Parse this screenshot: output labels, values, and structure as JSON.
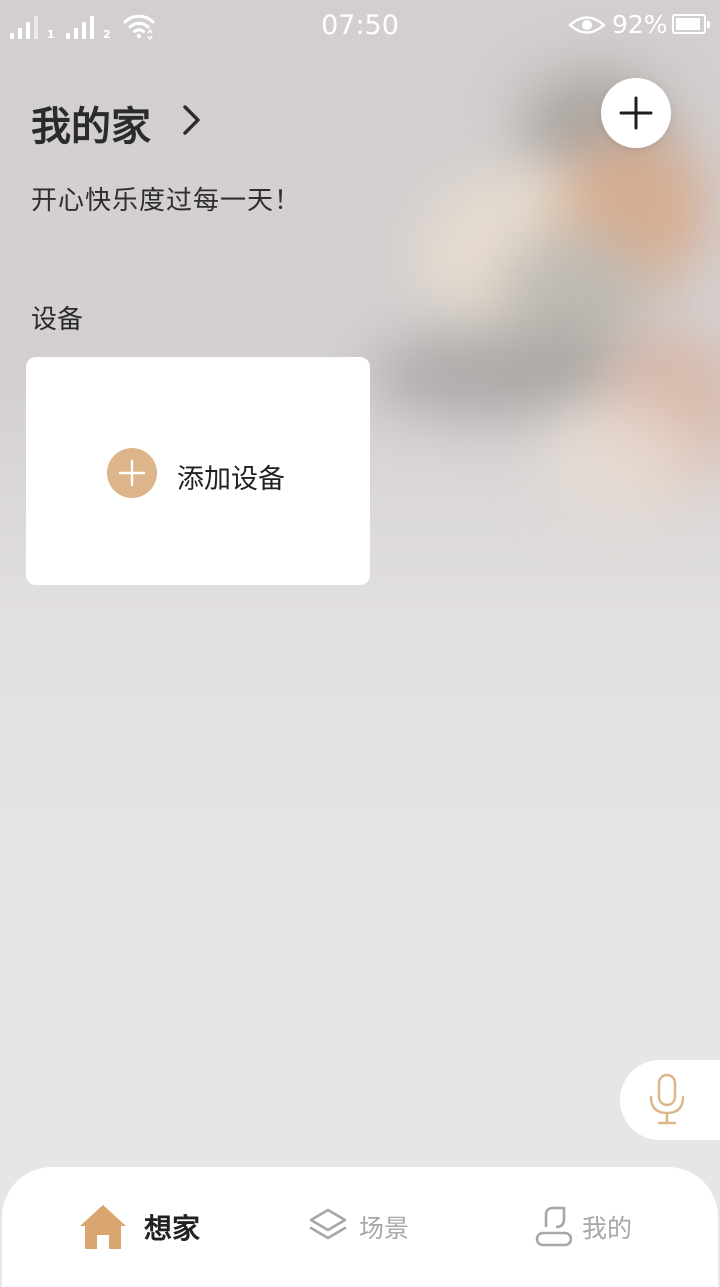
{
  "status_bar": {
    "time": "07:50",
    "battery_percent": "92%",
    "sim1_badge": "1",
    "sim2_badge": "2",
    "icons": [
      "signal-icon",
      "wifi-icon",
      "eye-comfort-icon",
      "battery-icon"
    ]
  },
  "header": {
    "home_name": "我的家",
    "greeting": "开心快乐度过每一天！",
    "add_icon": "plus-icon",
    "chevron_icon": "chevron-right-icon"
  },
  "devices": {
    "section_title": "设备",
    "add_device_label": "添加设备",
    "add_device_icon": "plus-circle-icon"
  },
  "voice": {
    "icon": "microphone-icon"
  },
  "bottom_nav": {
    "active_index": 0,
    "items": [
      {
        "label": "想家",
        "icon": "home-icon"
      },
      {
        "label": "场景",
        "icon": "layers-icon"
      },
      {
        "label": "我的",
        "icon": "person-icon"
      }
    ]
  },
  "colors": {
    "accent": "#dcb58a",
    "text_primary": "#2b2b2b",
    "nav_inactive": "#a7a7a7",
    "card_bg": "#ffffff"
  }
}
